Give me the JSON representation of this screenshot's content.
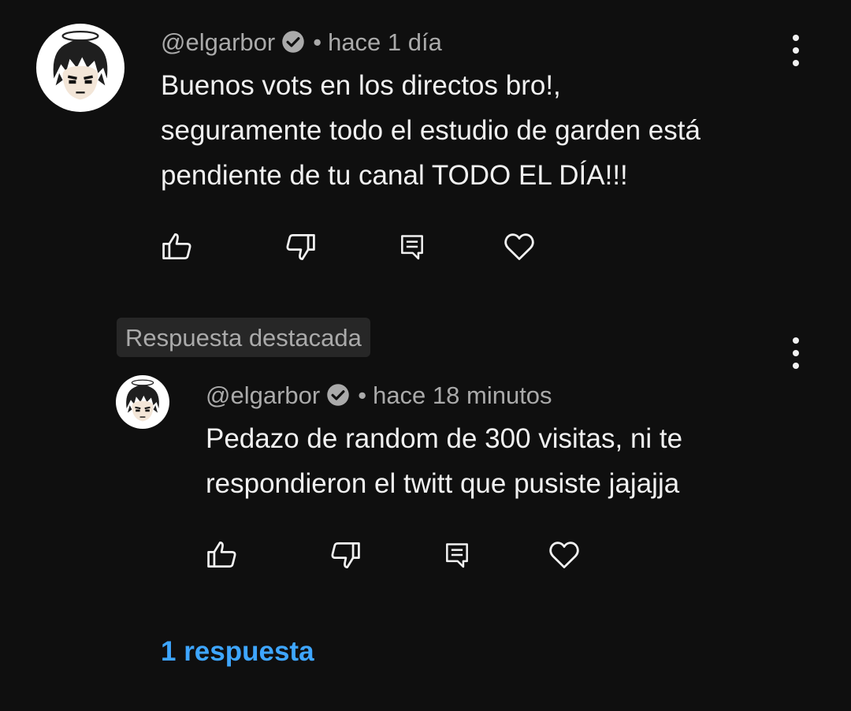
{
  "comment": {
    "author": "@elgarbor",
    "verified_icon": "verified-check-icon",
    "separator": "•",
    "time": "hace 1 día",
    "text": "Buenos vots en los directos bro!,\nseguramente todo el estudio de garden está\npendiente de tu canal TODO EL DÍA!!!",
    "actions": [
      "like-icon",
      "dislike-icon",
      "reply-icon",
      "heart-icon"
    ],
    "menu_icon": "more-vert-icon"
  },
  "highlighted_label": "Respuesta destacada",
  "reply": {
    "author": "@elgarbor",
    "verified_icon": "verified-check-icon",
    "separator": "•",
    "time": "hace 18 minutos",
    "text": "Pedazo de random de 300 visitas, ni te\nrespondieron el twitt que pusiste jajajja",
    "actions": [
      "like-icon",
      "dislike-icon",
      "reply-icon",
      "heart-icon"
    ],
    "menu_icon": "more-vert-icon"
  },
  "replies_link": "1 respuesta",
  "colors": {
    "background": "#0f0f0f",
    "text_primary": "#f1f1f1",
    "text_secondary": "#aaaaaa",
    "link": "#3ea6ff",
    "badge_bg": "#272727"
  }
}
